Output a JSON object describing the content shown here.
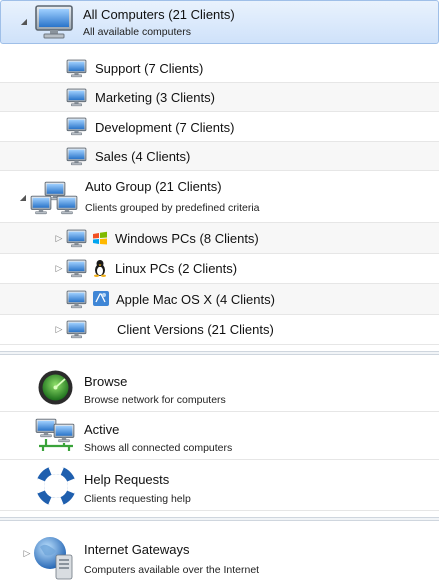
{
  "computers_section": {
    "all_computers": {
      "title": "All Computers (21 Clients)",
      "subtitle": "All available computers",
      "icon": "monitor-large-icon",
      "expanded": true,
      "children": [
        {
          "label": "Support (7 Clients)",
          "icon": "monitor-icon"
        },
        {
          "label": "Marketing (3 Clients)",
          "icon": "monitor-icon"
        },
        {
          "label": "Development (7 Clients)",
          "icon": "monitor-icon"
        },
        {
          "label": "Sales (4 Clients)",
          "icon": "monitor-icon"
        }
      ]
    },
    "auto_group": {
      "title": "Auto Group (21 Clients)",
      "subtitle": "Clients grouped by predefined criteria",
      "icon": "monitor-group-icon",
      "expanded": true,
      "children": [
        {
          "label": "Windows PCs (8 Clients)",
          "icon": "windows-logo-icon",
          "expandable": true
        },
        {
          "label": "Linux PCs (2 Clients)",
          "icon": "linux-tux-icon",
          "expandable": true
        },
        {
          "label": "Apple Mac OS X (4 Clients)",
          "icon": "apple-mac-icon",
          "expandable": false
        },
        {
          "label": "Client Versions (21 Clients)",
          "icon": "monitor-icon",
          "expandable": true
        }
      ]
    }
  },
  "tools_section": [
    {
      "title": "Browse",
      "subtitle": "Browse network for computers",
      "icon": "radar-browse-icon"
    },
    {
      "title": "Active",
      "subtitle": "Shows all connected computers",
      "icon": "network-active-icon"
    },
    {
      "title": "Help Requests",
      "subtitle": "Clients requesting help",
      "icon": "lifebuoy-icon"
    }
  ],
  "gateways_section": {
    "title": "Internet Gateways",
    "subtitle": "Computers available over the Internet",
    "icon": "globe-server-icon",
    "expanded": false
  },
  "colors": {
    "selection_top": "#e9f2fd",
    "selection_bottom": "#cfe2fa",
    "selection_border": "#9fbfe8",
    "stripe": "#f7f7f7"
  }
}
